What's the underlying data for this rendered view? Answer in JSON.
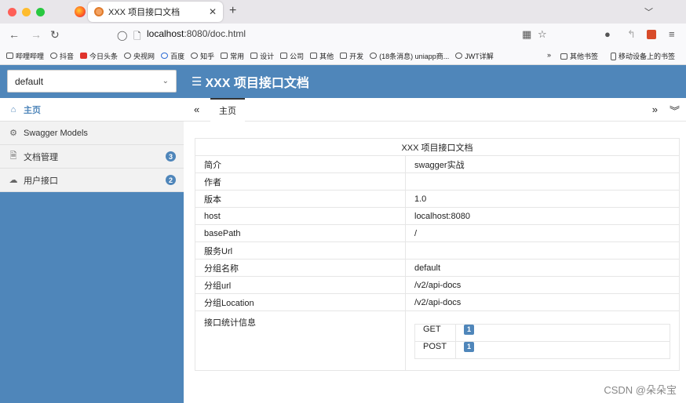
{
  "browser": {
    "tab_title": "XXX 项目接口文档",
    "url_host": "localhost",
    "url_rest": ":8080/doc.html",
    "bookmarks": [
      "哔哩哔哩",
      "抖音",
      "今日头条",
      "央视网",
      "百度",
      "知乎",
      "常用",
      "设计",
      "公司",
      "其他",
      "开发",
      "(18条消息) uniapp商...",
      "JWT详解"
    ],
    "bookmarks_right": [
      "其他书签",
      "移动设备上的书签"
    ],
    "chevron_more": "»"
  },
  "app": {
    "group_select": "default",
    "title": "XXX 项目接口文档"
  },
  "sidebar": {
    "items": [
      {
        "label": "主页"
      },
      {
        "label": "Swagger Models"
      },
      {
        "label": "文档管理",
        "badge": "3"
      },
      {
        "label": "用户接口",
        "badge": "2"
      }
    ]
  },
  "doc_tab": "主页",
  "info": {
    "header": "XXX 项目接口文档",
    "rows": [
      {
        "k": "简介",
        "v": "swagger实战"
      },
      {
        "k": "作者",
        "v": ""
      },
      {
        "k": "版本",
        "v": "1.0"
      },
      {
        "k": "host",
        "v": "localhost:8080"
      },
      {
        "k": "basePath",
        "v": "/"
      },
      {
        "k": "服务Url",
        "v": ""
      },
      {
        "k": "分组名称",
        "v": "default"
      },
      {
        "k": "分组url",
        "v": "/v2/api-docs"
      },
      {
        "k": "分组Location",
        "v": "/v2/api-docs"
      }
    ],
    "stats_label": "接口统计信息",
    "stats": [
      {
        "method": "GET",
        "count": "1"
      },
      {
        "method": "POST",
        "count": "1"
      }
    ]
  },
  "watermark": "CSDN @朵朵宝"
}
